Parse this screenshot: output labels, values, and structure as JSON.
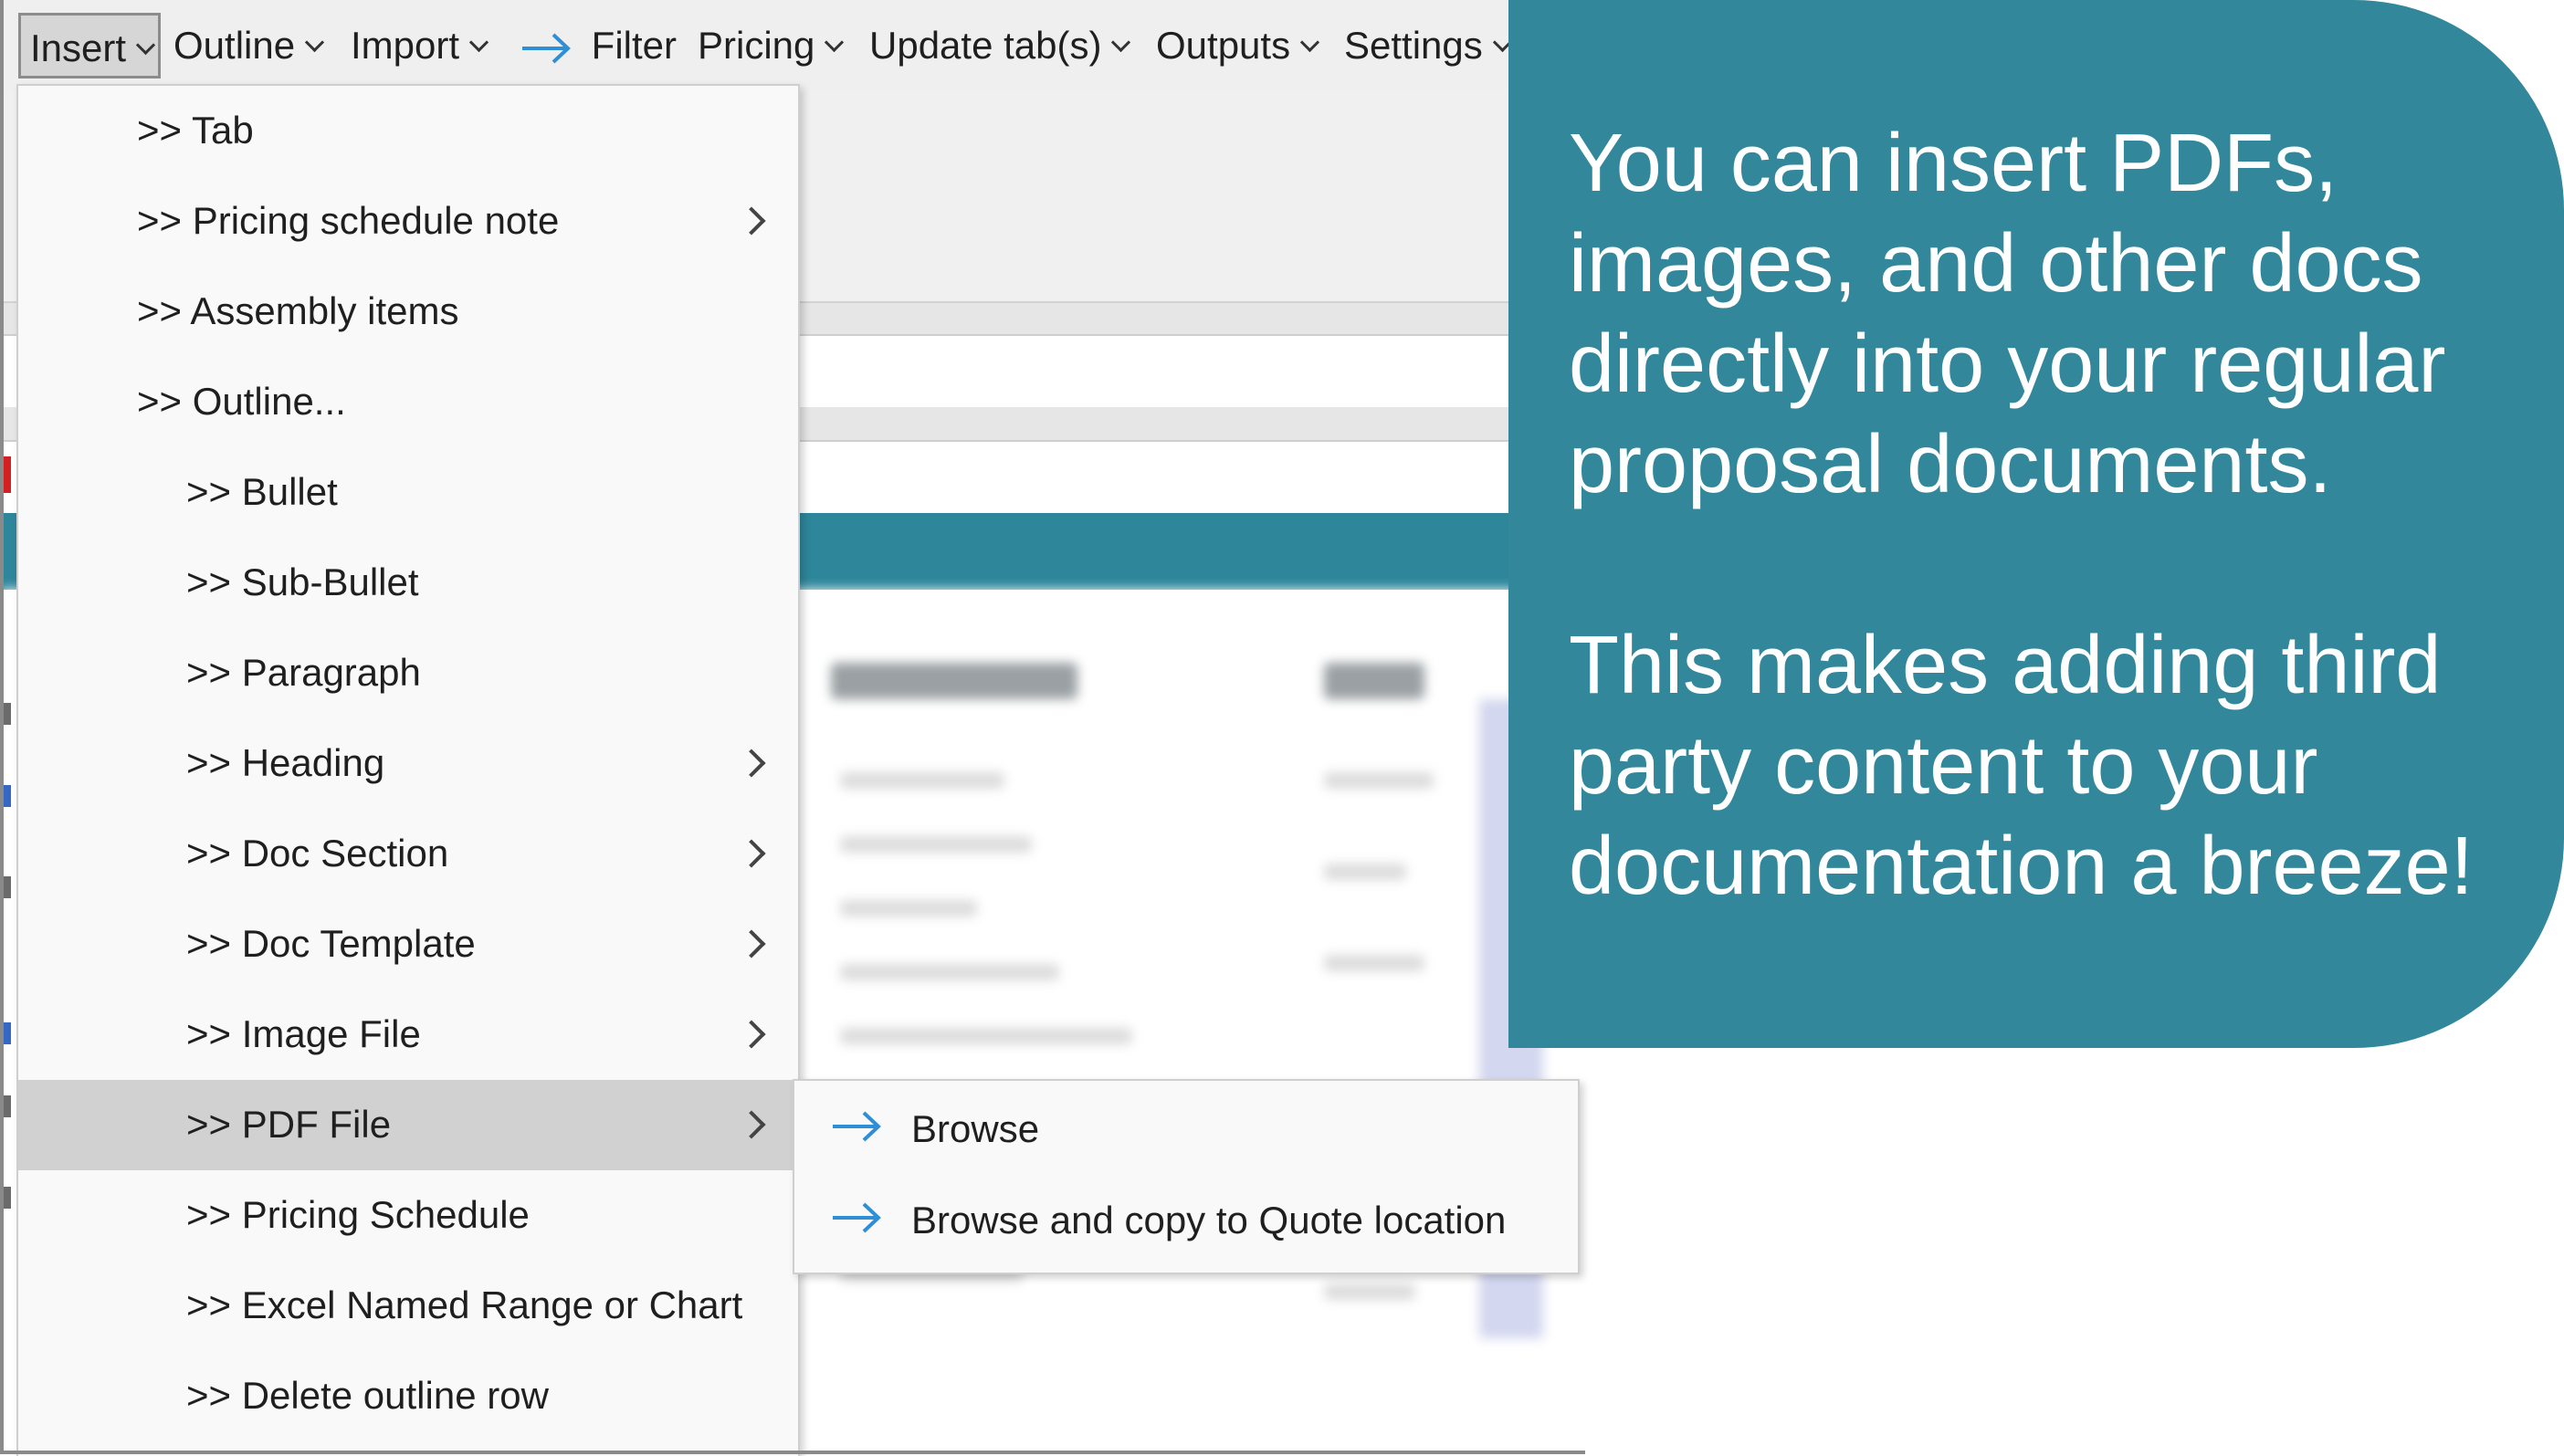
{
  "menubar": {
    "items": [
      {
        "label": "Insert",
        "has_dropdown": true,
        "active": true
      },
      {
        "label": "Outline",
        "has_dropdown": true
      },
      {
        "label": "Import",
        "has_dropdown": true
      },
      {
        "label": "Filter",
        "icon": "arrow-right-icon",
        "has_dropdown": false
      },
      {
        "label": "Pricing",
        "has_dropdown": true
      },
      {
        "label": "Update tab(s)",
        "has_dropdown": true
      },
      {
        "label": "Outputs",
        "has_dropdown": true
      },
      {
        "label": "Settings",
        "has_dropdown": true
      }
    ]
  },
  "insert_menu": {
    "items": [
      {
        "label": ">> Tab",
        "level": 0,
        "has_submenu": false
      },
      {
        "label": ">> Pricing schedule note",
        "level": 0,
        "has_submenu": true
      },
      {
        "label": ">> Assembly items",
        "level": 0,
        "has_submenu": false
      },
      {
        "label": ">> Outline...",
        "level": 0,
        "has_submenu": false
      },
      {
        "label": ">> Bullet",
        "level": 1,
        "has_submenu": false
      },
      {
        "label": ">> Sub-Bullet",
        "level": 1,
        "has_submenu": false
      },
      {
        "label": ">> Paragraph",
        "level": 1,
        "has_submenu": false
      },
      {
        "label": ">> Heading",
        "level": 1,
        "has_submenu": true
      },
      {
        "label": ">> Doc Section",
        "level": 1,
        "has_submenu": true
      },
      {
        "label": ">> Doc Template",
        "level": 1,
        "has_submenu": true
      },
      {
        "label": ">> Image File",
        "level": 1,
        "has_submenu": true
      },
      {
        "label": ">> PDF File",
        "level": 1,
        "has_submenu": true,
        "highlighted": true
      },
      {
        "label": ">> Pricing Schedule",
        "level": 1,
        "has_submenu": false
      },
      {
        "label": ">> Excel Named Range or Chart",
        "level": 1,
        "has_submenu": false
      },
      {
        "label": ">> Delete outline row",
        "level": 1,
        "has_submenu": false
      }
    ]
  },
  "pdf_submenu": {
    "items": [
      {
        "label": "Browse",
        "icon": "arrow-right-icon"
      },
      {
        "label": "Browse and copy to Quote location",
        "icon": "arrow-right-icon"
      }
    ]
  },
  "callout": {
    "paragraph_1": "You can insert PDFs, images, and other docs directly into your regular proposal documents.",
    "paragraph_2": "This makes adding third party content to your documentation a breeze!"
  },
  "colors": {
    "callout_bg": "#32879a",
    "app_teal_bar": "#2e869b",
    "arrow_accent": "#2f8fd6",
    "menu_highlight": "#d1d1d1",
    "menubar_bg": "#efefef"
  }
}
